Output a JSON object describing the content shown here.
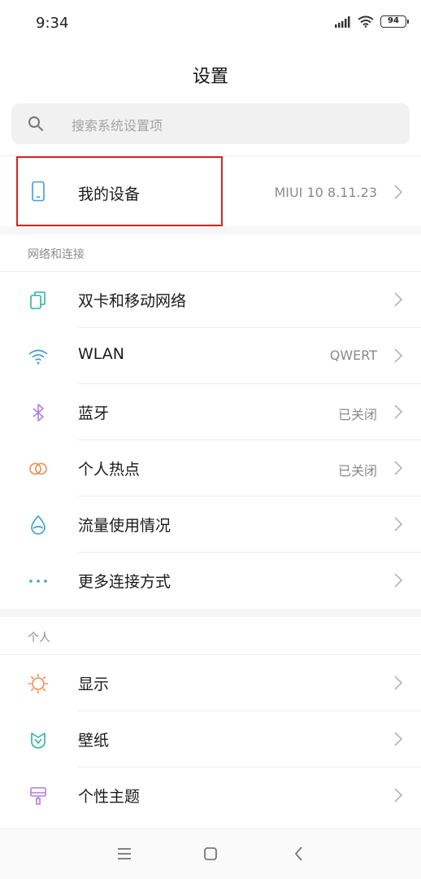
{
  "status_bar": {
    "time": "9:34",
    "battery": "94"
  },
  "title": "设置",
  "search": {
    "placeholder": "搜索系统设置项"
  },
  "my_device": {
    "label": "我的设备",
    "value": "MIUI 10 8.11.23"
  },
  "sections": {
    "network": {
      "header": "网络和连接",
      "items": [
        {
          "label": "双卡和移动网络",
          "value": "",
          "icon": "dual-sim-icon"
        },
        {
          "label": "WLAN",
          "value": "QWERT",
          "icon": "wifi-icon"
        },
        {
          "label": "蓝牙",
          "value": "已关闭",
          "icon": "bluetooth-icon"
        },
        {
          "label": "个人热点",
          "value": "已关闭",
          "icon": "hotspot-icon"
        },
        {
          "label": "流量使用情况",
          "value": "",
          "icon": "data-usage-icon"
        },
        {
          "label": "更多连接方式",
          "value": "",
          "icon": "more-connections-icon"
        }
      ]
    },
    "personal": {
      "header": "个人",
      "items": [
        {
          "label": "显示",
          "value": "",
          "icon": "display-icon"
        },
        {
          "label": "壁纸",
          "value": "",
          "icon": "wallpaper-icon"
        },
        {
          "label": "个性主题",
          "value": "",
          "icon": "themes-icon"
        }
      ]
    }
  },
  "colors": {
    "teal": "#2bb3a3",
    "blue": "#3a9fe0",
    "purple": "#b07ce8",
    "orange": "#f08b4c",
    "highlight": "#e0201e"
  }
}
